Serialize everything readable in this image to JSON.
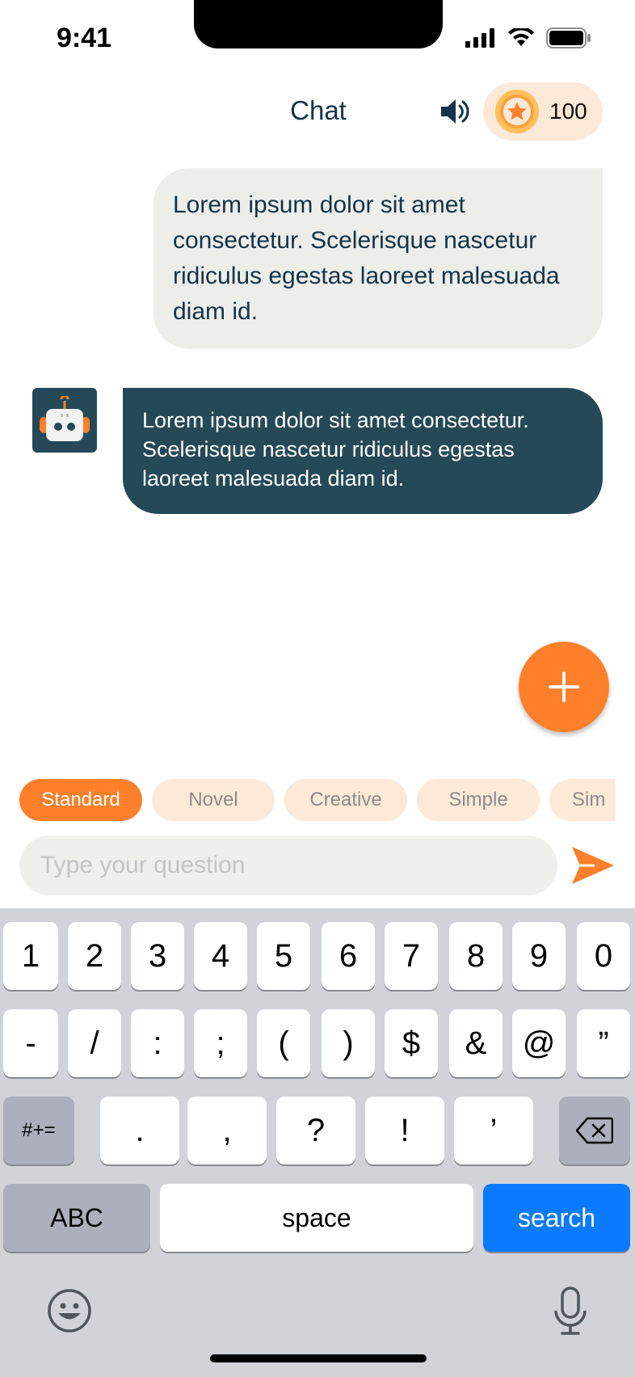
{
  "status_bar": {
    "time": "9:41"
  },
  "header": {
    "title": "Chat",
    "coin_count": "100"
  },
  "messages": {
    "user": "Lorem ipsum dolor sit amet consectetur. Scelerisque nascetur ridiculus egestas laoreet malesuada diam id.",
    "bot": "Lorem ipsum dolor sit amet consectetur. Scelerisque nascetur ridiculus egestas laoreet malesuada diam id."
  },
  "chips": [
    "Standard",
    "Novel",
    "Creative",
    "Simple",
    "Sim"
  ],
  "input": {
    "placeholder": "Type your question",
    "value": ""
  },
  "keyboard": {
    "row1": [
      "1",
      "2",
      "3",
      "4",
      "5",
      "6",
      "7",
      "8",
      "9",
      "0"
    ],
    "row2": [
      "-",
      "/",
      ":",
      ";",
      "(",
      ")",
      "$",
      "&",
      "@",
      "”"
    ],
    "row3": [
      "#+=",
      ".",
      ",",
      "?",
      "!",
      "’"
    ],
    "abc": "ABC",
    "space": "space",
    "search": "search"
  },
  "colors": {
    "accent": "#ff7f2a",
    "dark_bubble": "#254957",
    "chip_bg": "#fde9d7",
    "keyboard_blue": "#0a7aff"
  }
}
